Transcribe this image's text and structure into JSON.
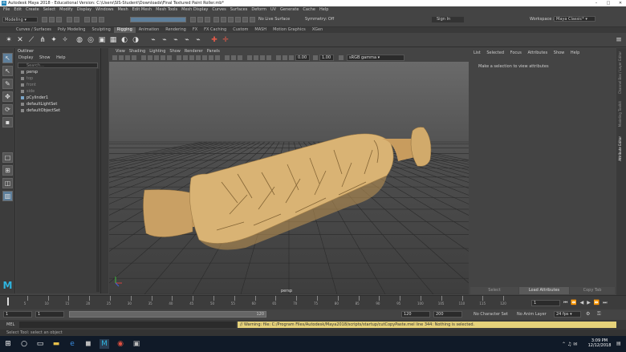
{
  "window": {
    "title": "Autodesk Maya 2018 - Educational Version: C:\\Users\\SIS-Student\\Downloads\\Final Textured Paint Roller.mb*",
    "workspace_label": "Workspace :",
    "workspace_value": "Maya Classic*"
  },
  "menubar": [
    "File",
    "Edit",
    "Create",
    "Select",
    "Modify",
    "Display",
    "Windows",
    "Mesh",
    "Edit Mesh",
    "Mesh Tools",
    "Mesh Display",
    "Curves",
    "Surfaces",
    "Deform",
    "UV",
    "Generate",
    "Cache",
    "Help"
  ],
  "toolbar": {
    "mode": "Modeling",
    "surface_label": "No Live Surface",
    "symmetry_label": "Symmetry: Off",
    "signin_label": "Sign In"
  },
  "shelf_tabs": [
    "Curves / Surfaces",
    "Poly Modeling",
    "Sculpting",
    "Rigging",
    "Animation",
    "Rendering",
    "FX",
    "FX Caching",
    "Custom",
    "MASH",
    "Motion Graphics",
    "XGen"
  ],
  "shelf_active": "Rigging",
  "outliner": {
    "title": "Outliner",
    "menu": [
      "Display",
      "Show",
      "Help"
    ],
    "search_placeholder": "Search...",
    "items": [
      {
        "label": "persp",
        "dim": false
      },
      {
        "label": "top",
        "dim": true
      },
      {
        "label": "front",
        "dim": true
      },
      {
        "label": "side",
        "dim": true
      },
      {
        "label": "pCylinder1",
        "dim": false
      },
      {
        "label": "defaultLightSet",
        "dim": false
      },
      {
        "label": "defaultObjectSet",
        "dim": false
      }
    ]
  },
  "viewport": {
    "menu": [
      "View",
      "Shading",
      "Lighting",
      "Show",
      "Renderer",
      "Panels"
    ],
    "exposure": "0.00",
    "gamma": "1.00",
    "color_space": "sRGB gamma",
    "camera_label": "persp"
  },
  "attribute_editor": {
    "menu": [
      "List",
      "Selected",
      "Focus",
      "Attributes",
      "Show",
      "Help"
    ],
    "message": "Make a selection to view attributes",
    "buttons": [
      "Select",
      "Load Attributes",
      "Copy Tab"
    ],
    "side_tabs": [
      "Channel Box / Layer Editor",
      "Modeling Toolkit",
      "Attribute Editor"
    ]
  },
  "timeline": {
    "ticks": [
      "5",
      "10",
      "15",
      "20",
      "25",
      "30",
      "35",
      "40",
      "45",
      "50",
      "55",
      "60",
      "65",
      "70",
      "75",
      "80",
      "85",
      "90",
      "95",
      "100",
      "105",
      "110",
      "115",
      "120"
    ],
    "current_frame": "1",
    "start_frame": "1",
    "range_start": "1",
    "range_handle": "120",
    "range_end": "120",
    "anim_end": "200",
    "char_set": "No Character Set",
    "anim_layer": "No Anim Layer",
    "fps": "24 fps"
  },
  "command": {
    "lang": "MEL",
    "warning": "// Warning: file: C:/Program Files/Autodesk/Maya2018/scripts/startup/cutCopyPaste.mel line 344: Nothing is selected."
  },
  "helpline": "Select Tool: select an object",
  "taskbar": {
    "time": "3:09 PM",
    "date": "12/12/2018"
  },
  "colors": {
    "accent": "#5e7f9b",
    "wood": "#d9b374",
    "taskbar": "#101a28"
  }
}
